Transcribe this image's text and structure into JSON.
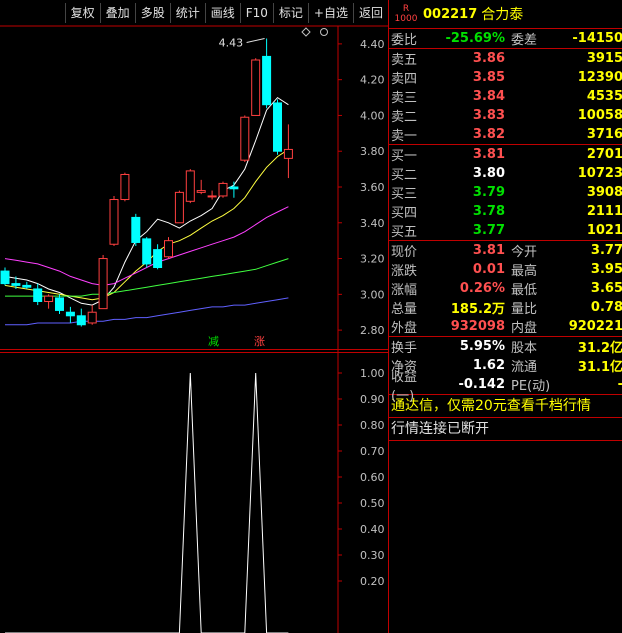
{
  "toolbar": {
    "buttons": [
      "复权",
      "叠加",
      "多股",
      "统计",
      "画线",
      "F10",
      "标记",
      "+自选",
      "返回"
    ]
  },
  "stock": {
    "badge_r": "R",
    "badge_num": "1000",
    "code": "002217",
    "name": "合力泰"
  },
  "quote": {
    "weibi_label": "委比",
    "weibi": "-25.69%",
    "weicha_label": "委差",
    "weicha": "-14150",
    "asks": [
      {
        "label": "卖五",
        "price": "3.86",
        "vol": "3915"
      },
      {
        "label": "卖四",
        "price": "3.85",
        "vol": "12390"
      },
      {
        "label": "卖三",
        "price": "3.84",
        "vol": "4535"
      },
      {
        "label": "卖二",
        "price": "3.83",
        "vol": "10058"
      },
      {
        "label": "卖一",
        "price": "3.82",
        "vol": "3716"
      }
    ],
    "bids": [
      {
        "label": "买一",
        "price": "3.81",
        "vol": "2701"
      },
      {
        "label": "买二",
        "price": "3.80",
        "vol": "10723"
      },
      {
        "label": "买三",
        "price": "3.79",
        "vol": "3908"
      },
      {
        "label": "买四",
        "price": "3.78",
        "vol": "2111"
      },
      {
        "label": "买五",
        "price": "3.77",
        "vol": "1021"
      }
    ],
    "stats": [
      {
        "l1": "现价",
        "v1": "3.81",
        "c1": "red",
        "l2": "今开",
        "v2": "3.77",
        "c2": "green"
      },
      {
        "l1": "涨跌",
        "v1": "0.01",
        "c1": "red",
        "l2": "最高",
        "v2": "3.95",
        "c2": "red"
      },
      {
        "l1": "涨幅",
        "v1": "0.26%",
        "c1": "red",
        "l2": "最低",
        "v2": "3.65",
        "c2": "green"
      },
      {
        "l1": "总量",
        "v1": "185.2万",
        "c1": "yellow",
        "l2": "量比",
        "v2": "0.78",
        "c2": "yellow"
      },
      {
        "l1": "外盘",
        "v1": "932098",
        "c1": "red",
        "l2": "内盘",
        "v2": "920221",
        "c2": "green"
      }
    ],
    "fund": [
      {
        "l1": "换手",
        "v1": "5.95%",
        "l2": "股本",
        "v2": "31.2亿"
      },
      {
        "l1": "净资",
        "v1": "1.62",
        "l2": "流通",
        "v2": "31.1亿"
      },
      {
        "l1": "收益(一)",
        "v1": "-0.142",
        "l2": "PE(动)",
        "v2": "-"
      }
    ],
    "promo": "通达信，仅需20元查看千档行情",
    "status": "行情连接已断开"
  },
  "colors": {
    "up": "#ff4040",
    "down": "#00ffff",
    "ma5": "#ffffff",
    "ma10": "#ffff40",
    "ma20": "#ff40ff",
    "ma60": "#40ff40",
    "ma120": "#6060ff",
    "frame": "#c00000",
    "ind": "#ffffff"
  },
  "chart_data": [
    {
      "type": "candlestick",
      "title": "",
      "ylim": [
        2.7,
        4.5
      ],
      "yticks": [
        "4.40",
        "4.20",
        "4.00",
        "3.80",
        "3.60",
        "3.40",
        "3.20",
        "3.00",
        "2.80"
      ],
      "annotation": "4.43",
      "candles": [
        {
          "o": 3.13,
          "h": 3.15,
          "l": 3.05,
          "c": 3.06
        },
        {
          "o": 3.06,
          "h": 3.1,
          "l": 3.03,
          "c": 3.05
        },
        {
          "o": 3.05,
          "h": 3.07,
          "l": 3.03,
          "c": 3.04
        },
        {
          "o": 3.03,
          "h": 3.06,
          "l": 2.94,
          "c": 2.96
        },
        {
          "o": 2.96,
          "h": 3.0,
          "l": 2.92,
          "c": 2.99
        },
        {
          "o": 2.98,
          "h": 3.0,
          "l": 2.89,
          "c": 2.91
        },
        {
          "o": 2.9,
          "h": 2.93,
          "l": 2.84,
          "c": 2.88
        },
        {
          "o": 2.88,
          "h": 2.92,
          "l": 2.82,
          "c": 2.83
        },
        {
          "o": 2.84,
          "h": 2.94,
          "l": 2.83,
          "c": 2.9
        },
        {
          "o": 2.92,
          "h": 3.22,
          "l": 2.92,
          "c": 3.2
        },
        {
          "o": 3.28,
          "h": 3.55,
          "l": 3.27,
          "c": 3.53
        },
        {
          "o": 3.53,
          "h": 3.68,
          "l": 3.52,
          "c": 3.67
        },
        {
          "o": 3.43,
          "h": 3.45,
          "l": 3.27,
          "c": 3.29
        },
        {
          "o": 3.31,
          "h": 3.32,
          "l": 3.15,
          "c": 3.17
        },
        {
          "o": 3.25,
          "h": 3.28,
          "l": 3.14,
          "c": 3.15
        },
        {
          "o": 3.21,
          "h": 3.32,
          "l": 3.2,
          "c": 3.3
        },
        {
          "o": 3.4,
          "h": 3.58,
          "l": 3.4,
          "c": 3.57
        },
        {
          "o": 3.52,
          "h": 3.7,
          "l": 3.51,
          "c": 3.69
        },
        {
          "o": 3.57,
          "h": 3.64,
          "l": 3.56,
          "c": 3.58
        },
        {
          "o": 3.55,
          "h": 3.58,
          "l": 3.53,
          "c": 3.55
        },
        {
          "o": 3.55,
          "h": 3.63,
          "l": 3.54,
          "c": 3.62
        },
        {
          "o": 3.6,
          "h": 3.63,
          "l": 3.54,
          "c": 3.59
        },
        {
          "o": 3.75,
          "h": 4.0,
          "l": 3.74,
          "c": 3.99
        },
        {
          "o": 4.0,
          "h": 4.32,
          "l": 4.0,
          "c": 4.31
        },
        {
          "o": 4.33,
          "h": 4.43,
          "l": 4.04,
          "c": 4.06
        },
        {
          "o": 4.07,
          "h": 4.09,
          "l": 3.78,
          "c": 3.8
        },
        {
          "o": 3.76,
          "h": 3.95,
          "l": 3.65,
          "c": 3.81
        }
      ],
      "ma": [
        {
          "name": "MA5",
          "values": [
            3.1,
            3.09,
            3.08,
            3.06,
            3.03,
            3.01,
            2.98,
            2.95,
            2.94,
            2.97,
            3.04,
            3.18,
            3.3,
            3.35,
            3.42,
            3.4,
            3.37,
            3.41,
            3.44,
            3.48,
            3.58,
            3.61,
            3.7,
            3.86,
            4.03,
            4.1,
            4.06
          ]
        },
        {
          "name": "MA10",
          "values": [
            3.05,
            3.04,
            3.03,
            3.02,
            3.01,
            3.0,
            2.99,
            2.98,
            2.97,
            2.98,
            3.01,
            3.07,
            3.13,
            3.18,
            3.24,
            3.28,
            3.3,
            3.33,
            3.37,
            3.41,
            3.44,
            3.48,
            3.54,
            3.63,
            3.71,
            3.77,
            3.81
          ]
        },
        {
          "name": "MA20",
          "values": [
            3.2,
            3.19,
            3.18,
            3.17,
            3.15,
            3.13,
            3.1,
            3.08,
            3.06,
            3.05,
            3.06,
            3.09,
            3.12,
            3.15,
            3.18,
            3.2,
            3.22,
            3.24,
            3.26,
            3.28,
            3.3,
            3.32,
            3.35,
            3.39,
            3.43,
            3.46,
            3.49
          ]
        },
        {
          "name": "MA60",
          "values": [
            2.99,
            2.99,
            2.99,
            2.99,
            2.99,
            2.99,
            2.99,
            2.99,
            3.0,
            3.0,
            3.01,
            3.02,
            3.03,
            3.04,
            3.05,
            3.06,
            3.07,
            3.08,
            3.09,
            3.1,
            3.11,
            3.12,
            3.13,
            3.14,
            3.16,
            3.18,
            3.2
          ]
        },
        {
          "name": "MA120",
          "values": [
            2.83,
            2.83,
            2.83,
            2.84,
            2.84,
            2.84,
            2.84,
            2.85,
            2.85,
            2.85,
            2.86,
            2.86,
            2.87,
            2.87,
            2.88,
            2.89,
            2.9,
            2.91,
            2.92,
            2.93,
            2.93,
            2.94,
            2.94,
            2.95,
            2.96,
            2.97,
            2.98
          ]
        }
      ]
    },
    {
      "type": "line",
      "title": "",
      "ylim": [
        0,
        1.05
      ],
      "yticks": [
        "1.00",
        "0.90",
        "0.80",
        "0.70",
        "0.60",
        "0.50",
        "0.40",
        "0.30",
        "0.20"
      ],
      "markers": [
        "减",
        "涨"
      ],
      "values": [
        0,
        0,
        0,
        0,
        0,
        0,
        0,
        0,
        0,
        0,
        0,
        0,
        0,
        0,
        0,
        0,
        0,
        1.0,
        0,
        0,
        0,
        0,
        0,
        1.0,
        0,
        0,
        0
      ]
    }
  ]
}
